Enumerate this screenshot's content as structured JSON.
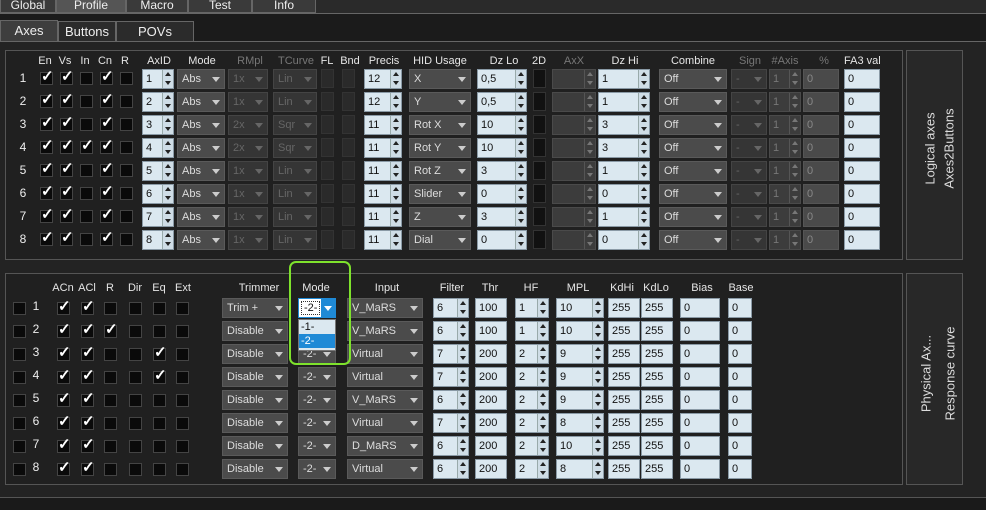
{
  "tabs_top": [
    "Global",
    "Profile",
    "Macro",
    "Test",
    "Info"
  ],
  "tabs_sub": [
    "Axes",
    "Buttons",
    "POVs"
  ],
  "logical": {
    "side_tab_1": "Logical axes",
    "side_tab_2": "Axes2Buttons",
    "headers": {
      "en": "En",
      "vs": "Vs",
      "in": "In",
      "cn": "Cn",
      "r": "R",
      "axid": "AxID",
      "mode": "Mode",
      "rmpl": "RMpl",
      "tcurve": "TCurve",
      "fl": "FL",
      "bnd": "Bnd",
      "precis": "Precis",
      "hid": "HID Usage",
      "dzlo": "Dz Lo",
      "twod": "2D",
      "axx": "AxX",
      "dzhi": "Dz Hi",
      "combine": "Combine",
      "sign": "Sign",
      "naxis": "#Axis",
      "pct": "%",
      "fa3": "FA3 val"
    },
    "rows": [
      {
        "n": "1",
        "en": true,
        "vs": true,
        "in": false,
        "cn": true,
        "r": false,
        "axid": "1",
        "mode": "Abs",
        "rmpl": "1x",
        "tcurve": "Lin",
        "precis": "12",
        "hid": "X",
        "dzlo": "0,5",
        "dzhi": "1",
        "combine": "Off",
        "sign": "-",
        "naxis": "1",
        "pct": "0",
        "fa3": "0"
      },
      {
        "n": "2",
        "en": true,
        "vs": true,
        "in": false,
        "cn": true,
        "r": false,
        "axid": "2",
        "mode": "Abs",
        "rmpl": "1x",
        "tcurve": "Lin",
        "precis": "12",
        "hid": "Y",
        "dzlo": "0,5",
        "dzhi": "1",
        "combine": "Off",
        "sign": "-",
        "naxis": "1",
        "pct": "0",
        "fa3": "0"
      },
      {
        "n": "3",
        "en": true,
        "vs": true,
        "in": false,
        "cn": true,
        "r": false,
        "axid": "3",
        "mode": "Abs",
        "rmpl": "2x",
        "tcurve": "Sqr",
        "precis": "11",
        "hid": "Rot X",
        "dzlo": "10",
        "dzhi": "3",
        "combine": "Off",
        "sign": "-",
        "naxis": "1",
        "pct": "0",
        "fa3": "0"
      },
      {
        "n": "4",
        "en": true,
        "vs": true,
        "in": true,
        "cn": true,
        "r": false,
        "axid": "4",
        "mode": "Abs",
        "rmpl": "2x",
        "tcurve": "Sqr",
        "precis": "11",
        "hid": "Rot Y",
        "dzlo": "10",
        "dzhi": "3",
        "combine": "Off",
        "sign": "-",
        "naxis": "1",
        "pct": "0",
        "fa3": "0"
      },
      {
        "n": "5",
        "en": true,
        "vs": true,
        "in": false,
        "cn": true,
        "r": false,
        "axid": "5",
        "mode": "Abs",
        "rmpl": "1x",
        "tcurve": "Lin",
        "precis": "11",
        "hid": "Rot Z",
        "dzlo": "3",
        "dzhi": "1",
        "combine": "Off",
        "sign": "-",
        "naxis": "1",
        "pct": "0",
        "fa3": "0"
      },
      {
        "n": "6",
        "en": true,
        "vs": true,
        "in": false,
        "cn": true,
        "r": false,
        "axid": "6",
        "mode": "Abs",
        "rmpl": "1x",
        "tcurve": "Lin",
        "precis": "11",
        "hid": "Slider",
        "dzlo": "0",
        "dzhi": "0",
        "combine": "Off",
        "sign": "-",
        "naxis": "1",
        "pct": "0",
        "fa3": "0"
      },
      {
        "n": "7",
        "en": true,
        "vs": true,
        "in": false,
        "cn": true,
        "r": false,
        "axid": "7",
        "mode": "Abs",
        "rmpl": "1x",
        "tcurve": "Lin",
        "precis": "11",
        "hid": "Z",
        "dzlo": "3",
        "dzhi": "1",
        "combine": "Off",
        "sign": "-",
        "naxis": "1",
        "pct": "0",
        "fa3": "0"
      },
      {
        "n": "8",
        "en": true,
        "vs": true,
        "in": false,
        "cn": true,
        "r": false,
        "axid": "8",
        "mode": "Abs",
        "rmpl": "1x",
        "tcurve": "Lin",
        "precis": "11",
        "hid": "Dial",
        "dzlo": "0",
        "dzhi": "0",
        "combine": "Off",
        "sign": "-",
        "naxis": "1",
        "pct": "0",
        "fa3": "0"
      }
    ]
  },
  "physical": {
    "side_tab_1": "Physical Ax...",
    "side_tab_2": "Response curve",
    "headers": {
      "acn": "ACn",
      "acl": "ACl",
      "r": "R",
      "dir": "Dir",
      "eq": "Eq",
      "ext": "Ext",
      "trimmer": "Trimmer",
      "mode": "Mode",
      "input": "Input",
      "filter": "Filter",
      "thr": "Thr",
      "hf": "HF",
      "mpl": "MPL",
      "kdhi": "KdHi",
      "kdlo": "KdLo",
      "bias": "Bias",
      "base": "Base"
    },
    "mode_dropdown": {
      "current": "-2-",
      "options": [
        "-1-",
        "-2-"
      ],
      "selected_index": 1
    },
    "rows": [
      {
        "n": "1",
        "acn": true,
        "acl": true,
        "r": false,
        "dir": false,
        "eq": false,
        "ext": false,
        "trimmer": "Trim +",
        "mode": "-2-",
        "input": "V_MaRS",
        "filter": "6",
        "thr": "100",
        "hf": "1",
        "mpl": "10",
        "kdhi": "255",
        "kdlo": "255",
        "bias": "0",
        "base": "0"
      },
      {
        "n": "2",
        "acn": true,
        "acl": true,
        "r": true,
        "dir": false,
        "eq": false,
        "ext": false,
        "trimmer": "Disable",
        "mode": "-2-",
        "input": "V_MaRS",
        "filter": "6",
        "thr": "100",
        "hf": "1",
        "mpl": "10",
        "kdhi": "255",
        "kdlo": "255",
        "bias": "0",
        "base": "0"
      },
      {
        "n": "3",
        "acn": true,
        "acl": true,
        "r": false,
        "dir": false,
        "eq": true,
        "ext": false,
        "trimmer": "Disable",
        "mode": "-2-",
        "input": "Virtual",
        "filter": "7",
        "thr": "200",
        "hf": "2",
        "mpl": "9",
        "kdhi": "255",
        "kdlo": "255",
        "bias": "0",
        "base": "0"
      },
      {
        "n": "4",
        "acn": true,
        "acl": true,
        "r": false,
        "dir": false,
        "eq": true,
        "ext": false,
        "trimmer": "Disable",
        "mode": "-2-",
        "input": "Virtual",
        "filter": "7",
        "thr": "200",
        "hf": "2",
        "mpl": "9",
        "kdhi": "255",
        "kdlo": "255",
        "bias": "0",
        "base": "0"
      },
      {
        "n": "5",
        "acn": true,
        "acl": true,
        "r": false,
        "dir": false,
        "eq": false,
        "ext": false,
        "trimmer": "Disable",
        "mode": "-2-",
        "input": "V_MaRS",
        "filter": "6",
        "thr": "200",
        "hf": "2",
        "mpl": "9",
        "kdhi": "255",
        "kdlo": "255",
        "bias": "0",
        "base": "0"
      },
      {
        "n": "6",
        "acn": true,
        "acl": true,
        "r": false,
        "dir": false,
        "eq": false,
        "ext": false,
        "trimmer": "Disable",
        "mode": "-2-",
        "input": "Virtual",
        "filter": "7",
        "thr": "200",
        "hf": "2",
        "mpl": "8",
        "kdhi": "255",
        "kdlo": "255",
        "bias": "0",
        "base": "0"
      },
      {
        "n": "7",
        "acn": true,
        "acl": true,
        "r": false,
        "dir": false,
        "eq": false,
        "ext": false,
        "trimmer": "Disable",
        "mode": "-2-",
        "input": "D_MaRS",
        "filter": "6",
        "thr": "200",
        "hf": "2",
        "mpl": "10",
        "kdhi": "255",
        "kdlo": "255",
        "bias": "0",
        "base": "0"
      },
      {
        "n": "8",
        "acn": true,
        "acl": true,
        "r": false,
        "dir": false,
        "eq": false,
        "ext": false,
        "trimmer": "Disable",
        "mode": "-2-",
        "input": "Virtual",
        "filter": "6",
        "thr": "200",
        "hf": "2",
        "mpl": "8",
        "kdhi": "255",
        "kdlo": "255",
        "bias": "0",
        "base": "0"
      }
    ]
  },
  "colors": {
    "highlight": "#7ee22c",
    "selected_option": "#1f8ad6",
    "field_bg": "#dbe8f0"
  }
}
